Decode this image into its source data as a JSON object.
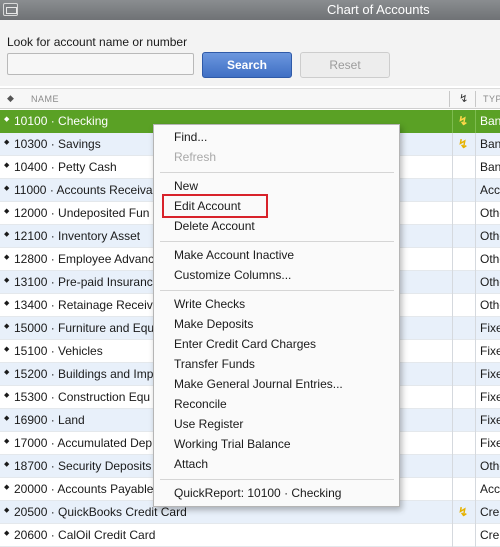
{
  "window": {
    "title": "Chart of Accounts"
  },
  "search": {
    "label": "Look for account name or number",
    "value": "",
    "placeholder": "",
    "search_button": "Search",
    "reset_button": "Reset"
  },
  "table": {
    "col_name": "NAME",
    "col_type": "TYP",
    "online_icon": "lightning-bolt-icon",
    "rows": [
      {
        "name": "10100 · Checking",
        "online": true,
        "type": "Ban"
      },
      {
        "name": "10300 · Savings",
        "online": true,
        "type": "Ban"
      },
      {
        "name": "10400 · Petty Cash",
        "online": false,
        "type": "Ban"
      },
      {
        "name": "11000 · Accounts Receiva",
        "online": false,
        "type": "Acc"
      },
      {
        "name": "12000 · Undeposited Fun",
        "online": false,
        "type": "Othe"
      },
      {
        "name": "12100 · Inventory Asset",
        "online": false,
        "type": "Othe"
      },
      {
        "name": "12800 · Employee Advanc",
        "online": false,
        "type": "Othe"
      },
      {
        "name": "13100 · Pre-paid Insuranc",
        "online": false,
        "type": "Othe"
      },
      {
        "name": "13400 · Retainage Receiv",
        "online": false,
        "type": "Othe"
      },
      {
        "name": "15000 · Furniture and Equ",
        "online": false,
        "type": "Fixe"
      },
      {
        "name": "15100 · Vehicles",
        "online": false,
        "type": "Fixe"
      },
      {
        "name": "15200 · Buildings and Imp",
        "online": false,
        "type": "Fixe"
      },
      {
        "name": "15300 · Construction Equ",
        "online": false,
        "type": "Fixe"
      },
      {
        "name": "16900 · Land",
        "online": false,
        "type": "Fixe"
      },
      {
        "name": "17000 · Accumulated Dep",
        "online": false,
        "type": "Fixe"
      },
      {
        "name": "18700 · Security Deposits",
        "online": false,
        "type": "Othe"
      },
      {
        "name": "20000 · Accounts Payable",
        "online": false,
        "type": "Acc"
      },
      {
        "name": "20500 · QuickBooks Credit Card",
        "online": true,
        "type": "Cre"
      },
      {
        "name": "20600 · CalOil Credit Card",
        "online": false,
        "type": "Cre"
      }
    ]
  },
  "context_menu": {
    "items": [
      {
        "label": "Find...",
        "disabled": false
      },
      {
        "label": "Refresh",
        "disabled": true
      },
      {
        "label": "New",
        "disabled": false
      },
      {
        "label": "Edit Account",
        "disabled": false
      },
      {
        "label": "Delete Account",
        "disabled": false
      },
      {
        "label": "Make Account Inactive",
        "disabled": false
      },
      {
        "label": "Customize Columns...",
        "disabled": false
      },
      {
        "label": "Write Checks",
        "disabled": false
      },
      {
        "label": "Make Deposits",
        "disabled": false
      },
      {
        "label": "Enter Credit Card Charges",
        "disabled": false
      },
      {
        "label": "Transfer Funds",
        "disabled": false
      },
      {
        "label": "Make General Journal Entries...",
        "disabled": false
      },
      {
        "label": "Reconcile",
        "disabled": false
      },
      {
        "label": "Use Register",
        "disabled": false
      },
      {
        "label": "Working Trial Balance",
        "disabled": false
      },
      {
        "label": "Attach",
        "disabled": false
      },
      {
        "label": "QuickReport: 10100 · Checking",
        "disabled": false
      }
    ]
  },
  "colors": {
    "selected_row": "#5aa125",
    "alt_row": "#e8f0fa",
    "search_button": "#4a7bd0",
    "highlight_box": "#d8222a"
  }
}
